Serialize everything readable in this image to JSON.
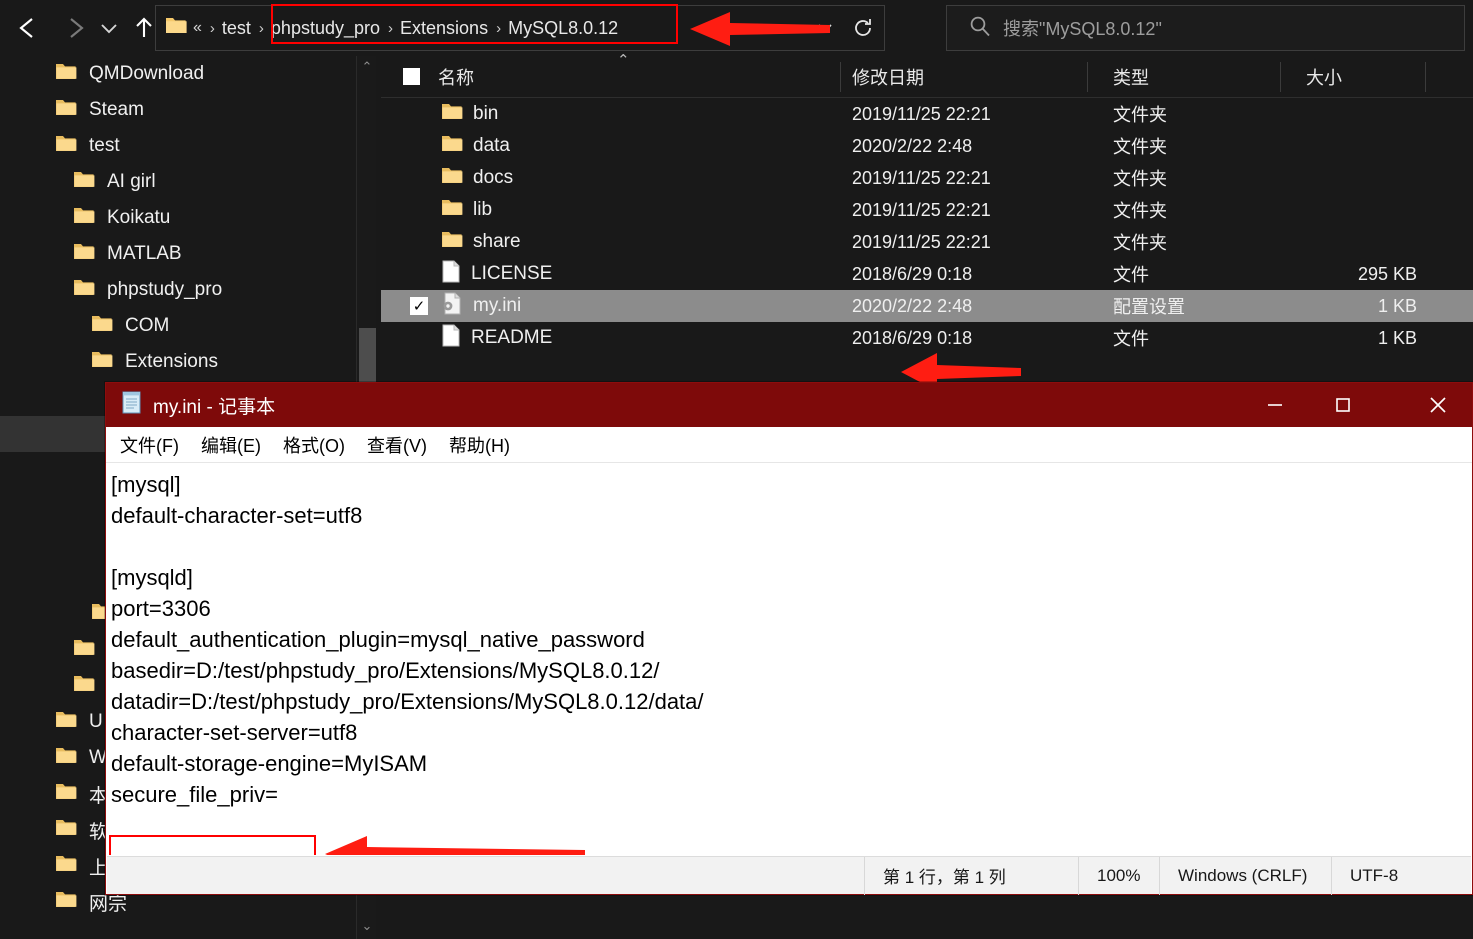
{
  "explorer": {
    "nav": {
      "back_label": "←",
      "forward_label": "→",
      "recent_label": "⌄",
      "up_label": "↑"
    },
    "address": {
      "overflow": "«",
      "crumbs": [
        {
          "label": "test",
          "sep": "›"
        },
        {
          "label": "phpstudy_pro",
          "sep": "›"
        },
        {
          "label": "Extensions",
          "sep": "›"
        },
        {
          "label": "MySQL8.0.12",
          "sep": ""
        }
      ],
      "dropdown_icon": "chevron-down-icon",
      "dropdown_label": "⌄",
      "refresh_label": "↻",
      "highlight_color": "#ff0000"
    },
    "search": {
      "icon": "search-icon",
      "placeholder": "搜索\"MySQL8.0.12\""
    },
    "sidebar": {
      "items": [
        {
          "label": "QMDownload",
          "indent": 0,
          "highlighted": false
        },
        {
          "label": "Steam",
          "indent": 0,
          "highlighted": false
        },
        {
          "label": "test",
          "indent": 0,
          "highlighted": false
        },
        {
          "label": "AI girl",
          "indent": 1,
          "highlighted": false
        },
        {
          "label": "Koikatu",
          "indent": 1,
          "highlighted": false
        },
        {
          "label": "MATLAB",
          "indent": 1,
          "highlighted": false
        },
        {
          "label": "phpstudy_pro",
          "indent": 1,
          "highlighted": false
        },
        {
          "label": "COM",
          "indent": 2,
          "highlighted": false
        },
        {
          "label": "Extensions",
          "indent": 2,
          "highlighted": false
        },
        {
          "label": "",
          "indent": 3,
          "highlighted": false
        },
        {
          "label": "",
          "indent": 3,
          "highlighted": true
        },
        {
          "label": "",
          "indent": 3,
          "highlighted": false
        },
        {
          "label": "",
          "indent": 3,
          "highlighted": false
        },
        {
          "label": "",
          "indent": 3,
          "highlighted": false
        },
        {
          "label": "",
          "indent": 3,
          "highlighted": false
        },
        {
          "label": "",
          "indent": 2,
          "highlighted": false
        },
        {
          "label": "",
          "indent": 1,
          "highlighted": false
        },
        {
          "label": "",
          "indent": 1,
          "highlighted": false
        },
        {
          "label": "U",
          "indent": 0,
          "highlighted": false
        },
        {
          "label": "W",
          "indent": 0,
          "highlighted": false
        },
        {
          "label": "本",
          "indent": 0,
          "highlighted": false
        },
        {
          "label": "软",
          "indent": 0,
          "highlighted": false
        },
        {
          "label": "上海的数据库",
          "indent": 0,
          "highlighted": false
        },
        {
          "label": "网宗",
          "indent": 0,
          "highlighted": false
        }
      ],
      "scroll_up": "⌃",
      "scroll_down": "⌄"
    },
    "columns": [
      {
        "key": "name",
        "label": "名称"
      },
      {
        "key": "date",
        "label": "修改日期"
      },
      {
        "key": "type",
        "label": "类型"
      },
      {
        "key": "size",
        "label": "大小"
      }
    ],
    "sort_caret": "⌃",
    "rows": [
      {
        "name": "bin",
        "date": "2019/11/25 22:21",
        "type": "文件夹",
        "size": "",
        "icon": "folder-icon",
        "selected": false,
        "checked": false
      },
      {
        "name": "data",
        "date": "2020/2/22 2:48",
        "type": "文件夹",
        "size": "",
        "icon": "folder-icon",
        "selected": false,
        "checked": false
      },
      {
        "name": "docs",
        "date": "2019/11/25 22:21",
        "type": "文件夹",
        "size": "",
        "icon": "folder-icon",
        "selected": false,
        "checked": false
      },
      {
        "name": "lib",
        "date": "2019/11/25 22:21",
        "type": "文件夹",
        "size": "",
        "icon": "folder-icon",
        "selected": false,
        "checked": false
      },
      {
        "name": "share",
        "date": "2019/11/25 22:21",
        "type": "文件夹",
        "size": "",
        "icon": "folder-icon",
        "selected": false,
        "checked": false
      },
      {
        "name": "LICENSE",
        "date": "2018/6/29 0:18",
        "type": "文件",
        "size": "295 KB",
        "icon": "file-icon",
        "selected": false,
        "checked": false
      },
      {
        "name": "my.ini",
        "date": "2020/2/22 2:48",
        "type": "配置设置",
        "size": "1 KB",
        "icon": "config-file-icon",
        "selected": true,
        "checked": true
      },
      {
        "name": "README",
        "date": "2018/6/29 0:18",
        "type": "文件",
        "size": "1 KB",
        "icon": "file-icon",
        "selected": false,
        "checked": false
      }
    ]
  },
  "notepad": {
    "title": "my.ini - 记事本",
    "icon": "notepad-icon",
    "window_buttons": {
      "minimize": "—",
      "maximize": "▢",
      "close": "✕"
    },
    "menu": [
      {
        "label": "文件(F)",
        "mnemonic": "F"
      },
      {
        "label": "编辑(E)",
        "mnemonic": "E"
      },
      {
        "label": "格式(O)",
        "mnemonic": "O"
      },
      {
        "label": "查看(V)",
        "mnemonic": "V"
      },
      {
        "label": "帮助(H)",
        "mnemonic": "H"
      }
    ],
    "content_lines": [
      "[mysql]",
      "default-character-set=utf8",
      "",
      "[mysqld]",
      "port=3306",
      "default_authentication_plugin=mysql_native_password",
      "basedir=D:/test/phpstudy_pro/Extensions/MySQL8.0.12/",
      "datadir=D:/test/phpstudy_pro/Extensions/MySQL8.0.12/data/",
      "character-set-server=utf8",
      "default-storage-engine=MyISAM",
      "secure_file_priv="
    ],
    "highlighted_line": "secure_file_priv=",
    "status": {
      "position": "第 1 行，第 1 列",
      "zoom": "100%",
      "line_ending": "Windows (CRLF)",
      "encoding": "UTF-8"
    },
    "titlebar_color": "#7e0a0a",
    "annotation_color": "#ff0000"
  }
}
